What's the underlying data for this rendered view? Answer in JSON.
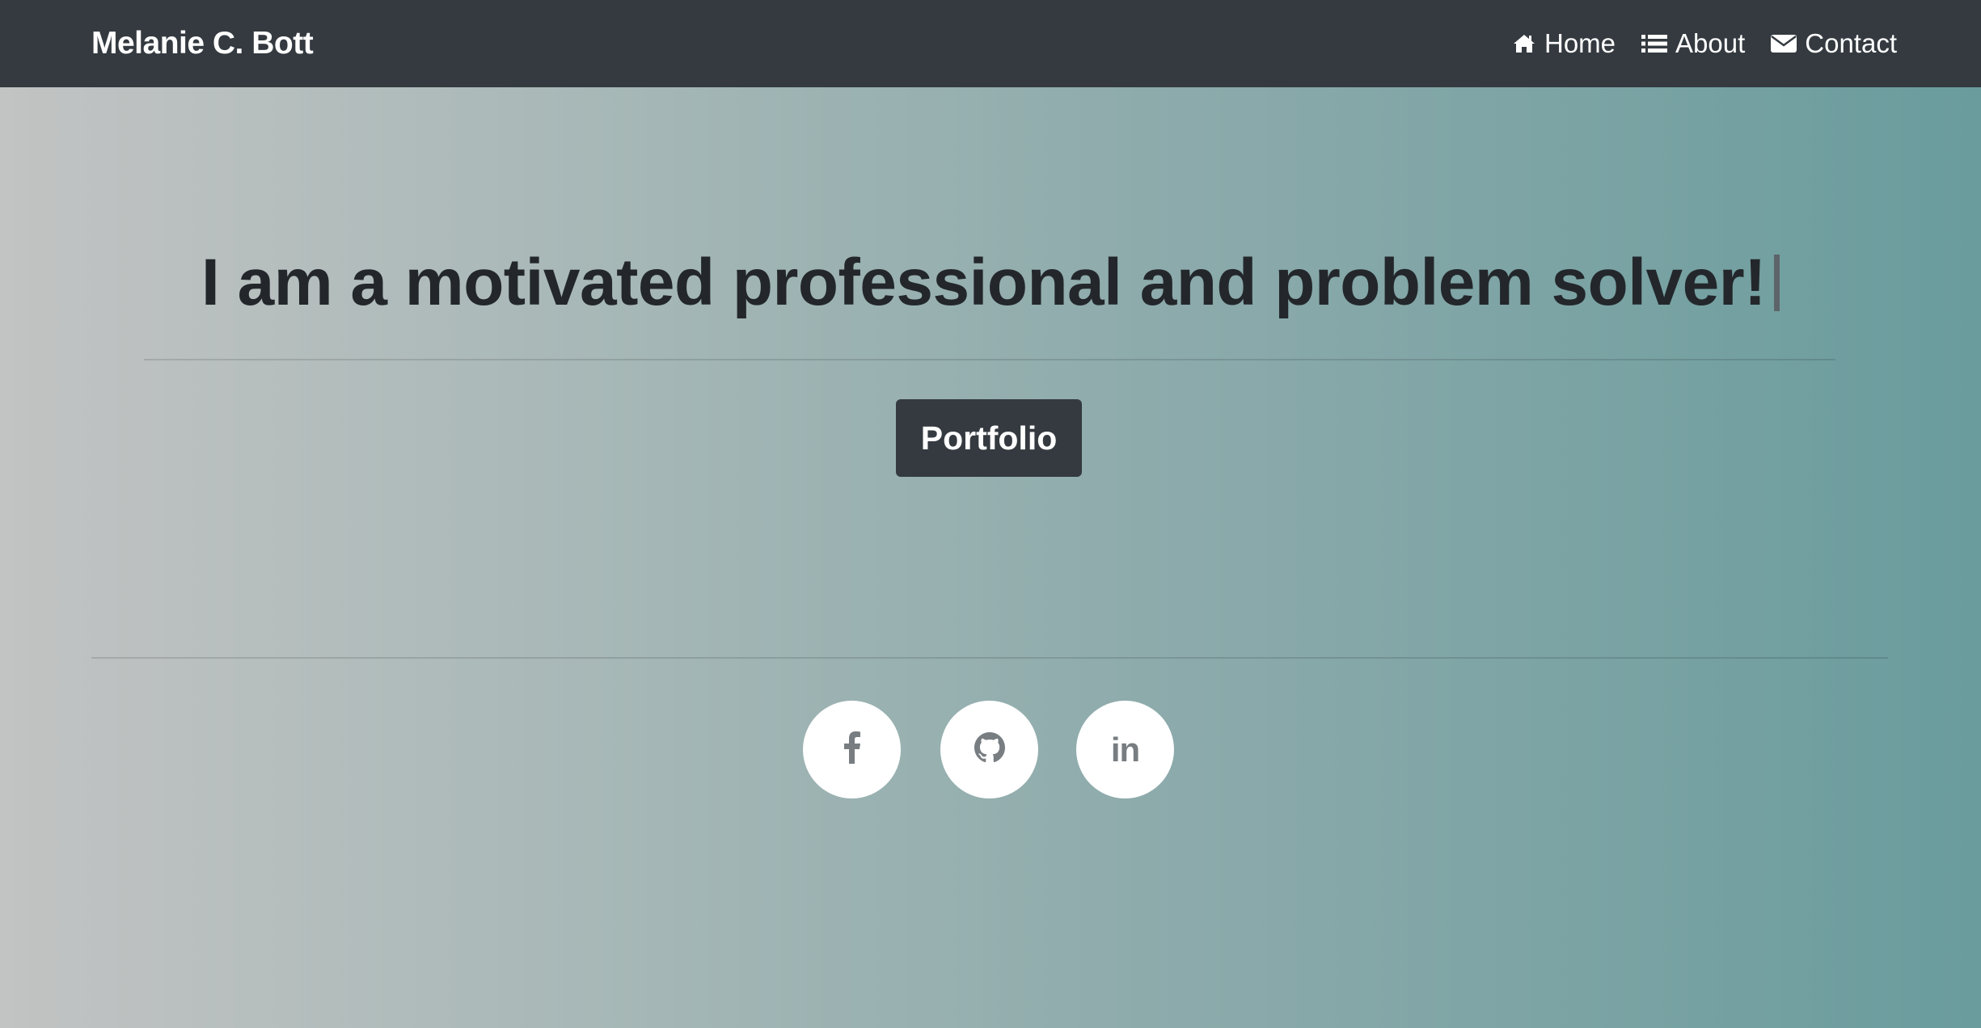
{
  "navbar": {
    "brand": "Melanie C. Bott",
    "items": [
      {
        "icon": "home-icon",
        "label": "Home"
      },
      {
        "icon": "list-icon",
        "label": "About"
      },
      {
        "icon": "envelope-icon",
        "label": "Contact"
      }
    ]
  },
  "hero": {
    "headline": "I am a motivated professional and problem solver!",
    "button_label": "Portfolio"
  },
  "social": {
    "facebook_icon": "facebook-icon",
    "github_icon": "github-icon",
    "linkedin_icon": "linkedin-icon",
    "linkedin_glyph": "in"
  },
  "colors": {
    "navbar_bg": "#343a40",
    "button_bg": "#343a40",
    "gradient_start": "#c2c3c3",
    "gradient_end": "#6a9c9d"
  }
}
